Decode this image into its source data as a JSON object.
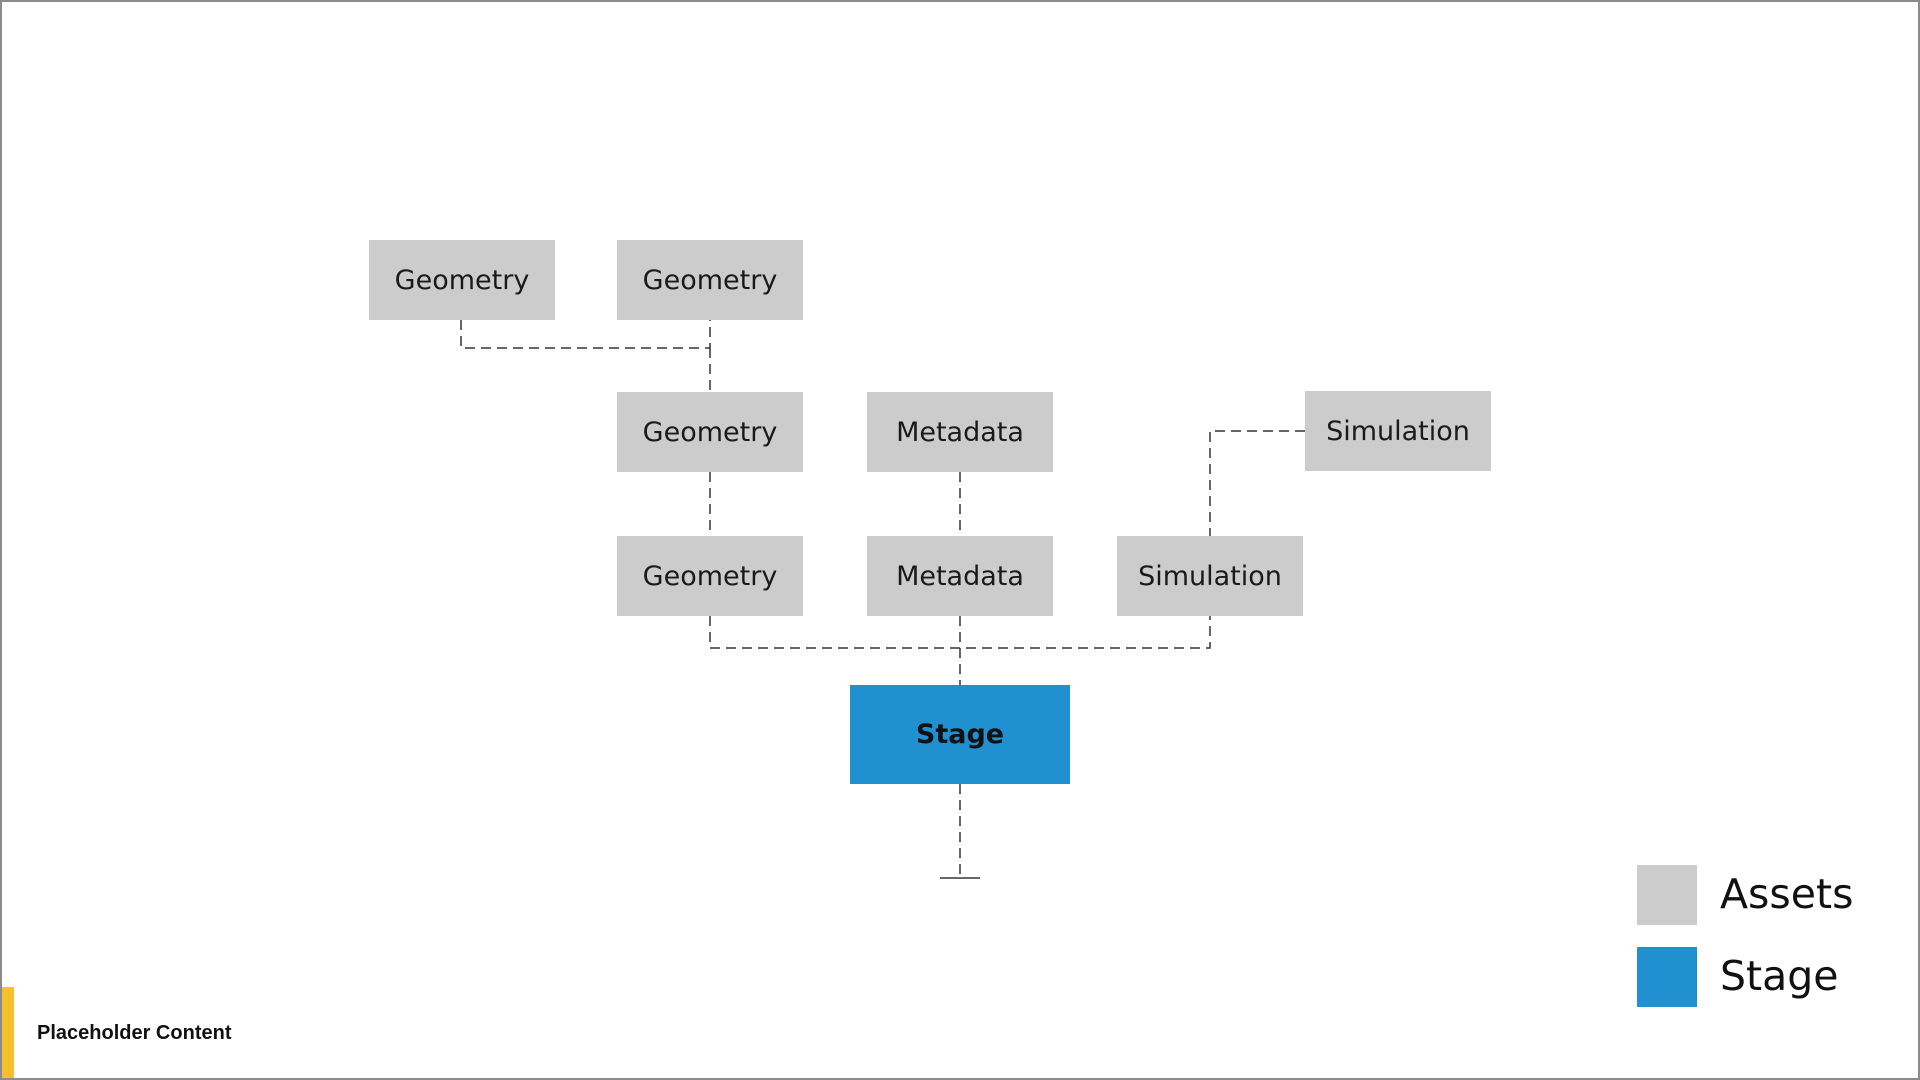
{
  "diagram": {
    "nodes": {
      "geometry_top_left": "Geometry",
      "geometry_top_right": "Geometry",
      "geometry_mid": "Geometry",
      "metadata_mid": "Metadata",
      "simulation_mid": "Simulation",
      "geometry_low": "Geometry",
      "metadata_low": "Metadata",
      "simulation_low": "Simulation",
      "stage": "Stage"
    }
  },
  "legend": {
    "assets_label": "Assets",
    "stage_label": "Stage"
  },
  "footer": {
    "text": "Placeholder Content"
  },
  "colors": {
    "asset": "#cccccc",
    "stage": "#2190d0",
    "footer_accent": "#f5c02c",
    "connector": "#333333"
  }
}
